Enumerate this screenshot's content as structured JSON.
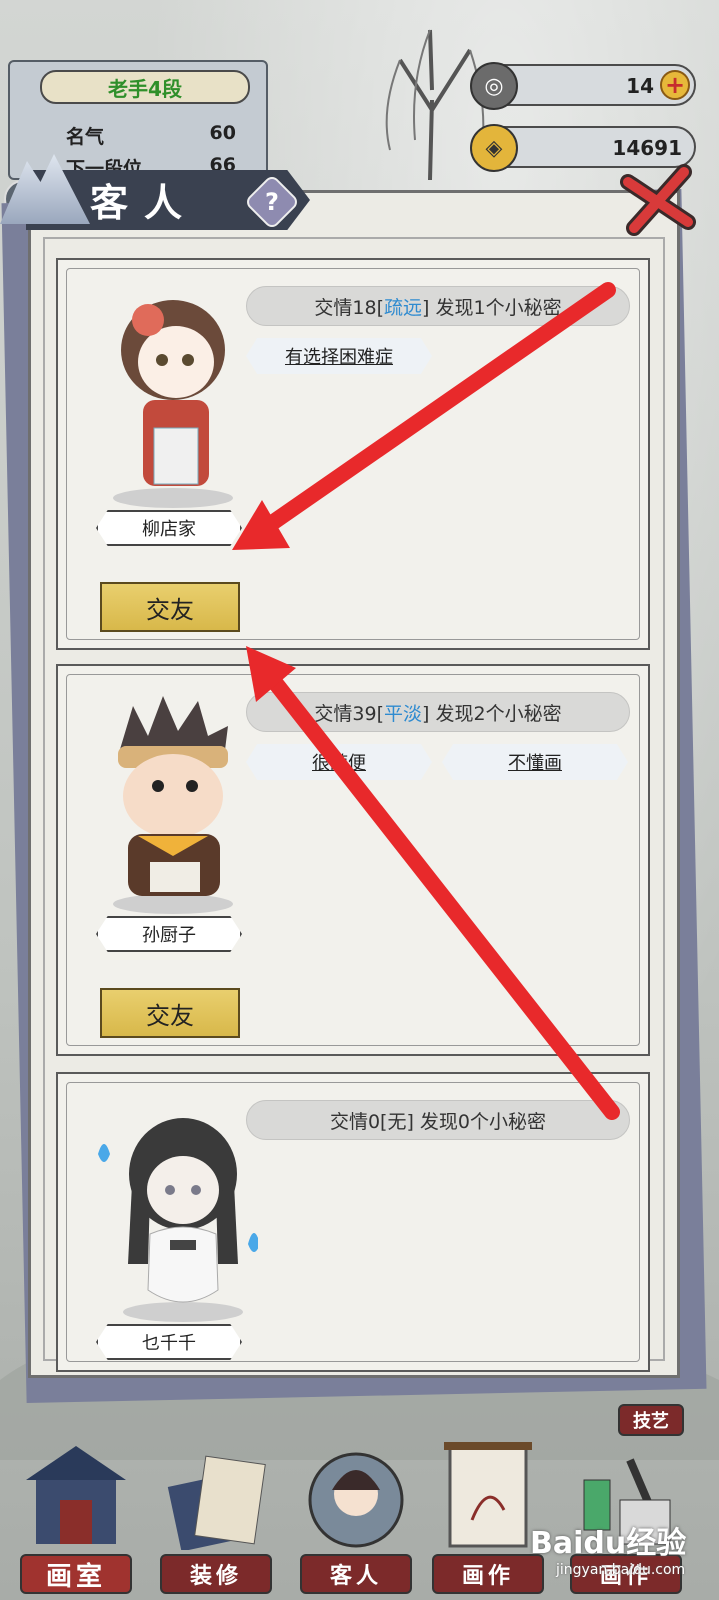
{
  "rank": {
    "title": "老手4段",
    "fame_label": "名气",
    "fame_value": "60",
    "next_label": "下一段位",
    "next_value": "66"
  },
  "currency": {
    "ink_value": "14",
    "coin_value": "14691",
    "plus_label": "+"
  },
  "modal": {
    "title": "客人",
    "help_label": "?"
  },
  "guests": [
    {
      "name": "柳店家",
      "friendship_prefix": "交情18[",
      "friendship_level": "疏远",
      "friendship_suffix": "] 发现1个小秘密",
      "traits": [
        "有选择困难症"
      ],
      "button": "交友"
    },
    {
      "name": "孙厨子",
      "friendship_prefix": "交情39[",
      "friendship_level": "平淡",
      "friendship_suffix": "] 发现2个小秘密",
      "traits": [
        "很随便",
        "不懂画"
      ],
      "button": "交友"
    },
    {
      "name": "乜千千",
      "friendship_prefix": "交情0[",
      "friendship_level": "无",
      "friendship_suffix": "] 发现0个小秘密",
      "traits": []
    }
  ],
  "nav": {
    "items": [
      "画室",
      "装修",
      "客人",
      "画作",
      "画作"
    ],
    "skill": "技艺"
  },
  "watermark": {
    "brand": "Baidu经验",
    "url": "jingyan.baidu.com"
  },
  "colors": {
    "highlight_blue": "#2f8bd0",
    "rank_green": "#2f8f2a",
    "arrow_red": "#e8292b",
    "button_gold": "#e0c25a",
    "nav_red": "#7c2a2a"
  }
}
